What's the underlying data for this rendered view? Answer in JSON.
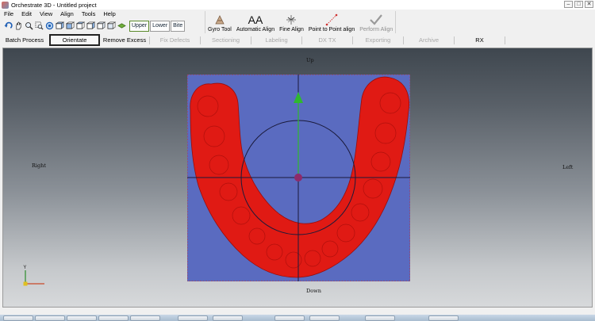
{
  "window": {
    "title": "Orchestrate 3D - Untitled project",
    "controls": [
      "–",
      "□",
      "✕"
    ]
  },
  "menu": [
    "File",
    "Edit",
    "View",
    "Align",
    "Tools",
    "Help"
  ],
  "toolbar": {
    "icons": [
      "undo-icon",
      "pan-hand-icon",
      "zoom-icon",
      "zoom-box-icon",
      "rotate-view-icon",
      "view-front-icon",
      "view-back-icon",
      "view-left-icon",
      "view-right-icon",
      "view-top-icon",
      "view-bottom-icon",
      "toggle-model-icon"
    ],
    "view_buttons": [
      "Upper",
      "Lower",
      "Bite"
    ]
  },
  "align_tools": [
    {
      "label": "Gyro Tool",
      "icon": "gyro-icon",
      "enabled": true
    },
    {
      "label": "Automatic Align",
      "glyph": "AA",
      "icon": "auto-align-icon",
      "enabled": true
    },
    {
      "label": "Fine Align",
      "icon": "fine-align-icon",
      "enabled": true
    },
    {
      "label": "Point to Point align",
      "icon": "point-align-icon",
      "enabled": true
    },
    {
      "label": "Perform Align",
      "icon": "checkmark-icon",
      "enabled": false
    }
  ],
  "steps": [
    {
      "label": "Batch Process",
      "state": "enabled"
    },
    {
      "label": "Orientate",
      "state": "active"
    },
    {
      "label": "Remove Excess",
      "state": "enabled"
    },
    {
      "label": "Fix Defects",
      "state": "disabled"
    },
    {
      "label": "Sectioning",
      "state": "disabled"
    },
    {
      "label": "Labeling",
      "state": "disabled"
    },
    {
      "label": "DX TX",
      "state": "disabled"
    },
    {
      "label": "Exporting",
      "state": "disabled"
    },
    {
      "label": "Archive",
      "state": "disabled"
    },
    {
      "label": "RX",
      "state": "enabled"
    }
  ],
  "viewport": {
    "up_label": "Up",
    "down_label": "Down",
    "left_label": "Left",
    "right_label": "Right",
    "axis_labels": {
      "y": "Y"
    },
    "colors": {
      "model": "#e01a14",
      "background_plane": "#5a6bc0",
      "gizmo_y": "#2fb82f",
      "gizmo_x": "#e07820",
      "bounding_box": "#c0303c"
    }
  }
}
